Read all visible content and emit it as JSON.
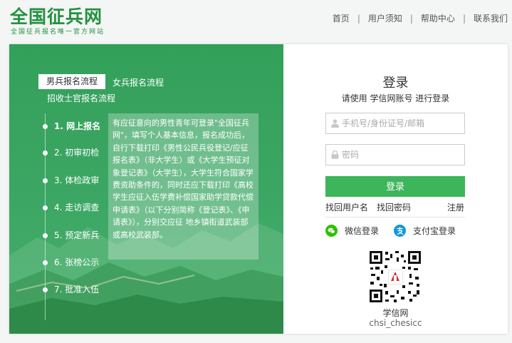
{
  "header": {
    "logo_title": "全国征兵网",
    "logo_subtitle": "全国征兵报名唯一官方网站",
    "nav": [
      "首页",
      "用户须知",
      "帮助中心",
      "联系我们"
    ]
  },
  "left_panel": {
    "tabs": {
      "male": "男兵报名流程",
      "female": "女兵报名流程",
      "sergeant": "招收士官报名流程"
    },
    "steps": [
      "1. 网上报名",
      "2. 初审初检",
      "3. 体检政审",
      "4. 走访调查",
      "5. 预定新兵",
      "6. 张榜公示",
      "7. 批准入伍"
    ],
    "active_step_description": "有应征意向的男性青年可登录\"全国征兵网\"，填写个人基本信息，报名成功后，自行下载打印《男性公民兵役登记/应征报名表》（非大学生）或《大学生预征对象登记表》（大学生），大学生符合国家学费资助条件的，同时还应下载打印《高校学生应征入伍学费补偿国家助学贷款代偿申请表》（以下分别简称《登记表》、《申请表》），分别交应征 地乡镇街道武装部或高校武装部。"
  },
  "login": {
    "title": "登录",
    "subtitle": "请使用  学信网账号  进行登录",
    "username_placeholder": "手机号/身份证号/邮箱",
    "password_placeholder": "密码",
    "login_button": "登录",
    "find_username": "找回用户名",
    "find_password": "找回密码",
    "register": "注册",
    "wechat_login": "微信登录",
    "alipay_login": "支付宝登录",
    "qr_label": "学信网",
    "qr_id": "chsi_chesicc"
  },
  "colors": {
    "brand_green": "#24913f",
    "panel_green": "#3ca764",
    "button_green": "#3cb55b",
    "wechat_green": "#2dc100",
    "alipay_blue": "#1296db"
  }
}
